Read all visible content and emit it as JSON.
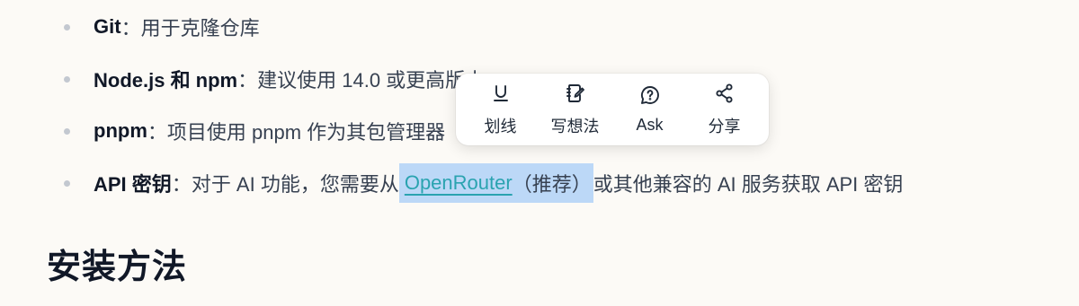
{
  "requirements": [
    {
      "term": "Git",
      "sep": "：",
      "desc": "用于克隆仓库"
    },
    {
      "term": "Node.js 和 npm",
      "sep": "：",
      "desc": "建议使用 14.0 或更高版本"
    },
    {
      "term": "pnpm",
      "sep": "：",
      "desc": "项目使用 pnpm 作为其包管理器"
    },
    {
      "term": "API 密钥",
      "sep": "：",
      "desc_before": "对于 AI 功能，您需要从 ",
      "link_text": "OpenRouter",
      "link_paren": "（推荐）",
      "desc_after": "或其他兼容的 AI 服务获取 API 密钥"
    }
  ],
  "section_heading": "安装方法",
  "popup": {
    "buttons": [
      {
        "label": "划线",
        "icon": "underline-icon"
      },
      {
        "label": "写想法",
        "icon": "notebook-pen-icon"
      },
      {
        "label": "Ask",
        "icon": "chat-question-icon"
      },
      {
        "label": "分享",
        "icon": "share-icon"
      }
    ]
  },
  "colors": {
    "background": "#fcfaf6",
    "link": "#2aa3b0",
    "selection": "#bcd8f7",
    "bullet": "#c3c8d0"
  }
}
